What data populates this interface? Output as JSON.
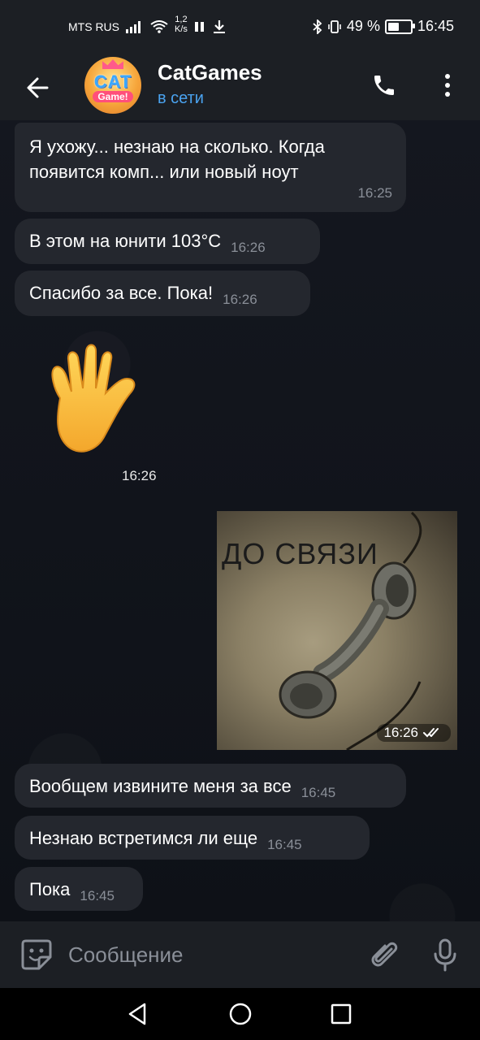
{
  "status_bar": {
    "carrier": "MTS RUS",
    "speed_value": "1,2",
    "speed_unit": "K/s",
    "battery": "49 %",
    "time": "16:45",
    "battery_level": 0.49
  },
  "header": {
    "title": "CatGames",
    "status": "в сети",
    "avatar": {
      "line1": "CAT",
      "line2": "Game!"
    },
    "icons": {
      "back": "arrow-left-icon",
      "call": "phone-icon",
      "more": "more-vertical-icon"
    }
  },
  "messages": [
    {
      "type": "text",
      "text": "Я ухожу... незнаю на сколько. Когда появится комп... или новый ноут",
      "time": "16:25"
    },
    {
      "type": "text",
      "text": "В этом на юнити 103°C",
      "time": "16:26"
    },
    {
      "type": "text",
      "text": "Спасибо за все. Пока!",
      "time": "16:26"
    },
    {
      "type": "sticker",
      "emoji": "waving-hand",
      "time": "16:26"
    },
    {
      "type": "photo",
      "caption": "ДО СВЯЗИ",
      "time": "16:26",
      "status": "read"
    },
    {
      "type": "text",
      "text": "Вообщем извините меня за все",
      "time": "16:45"
    },
    {
      "type": "text",
      "text": "Незнаю встретимся ли еще",
      "time": "16:45"
    },
    {
      "type": "text",
      "text": "Пока",
      "time": "16:45"
    }
  ],
  "input": {
    "placeholder": "Сообщение",
    "icons": {
      "emoji": "sticker-smile-icon",
      "attach": "paperclip-icon",
      "mic": "microphone-icon"
    }
  },
  "nav": {
    "icons": [
      "nav-back-icon",
      "nav-home-icon",
      "nav-recent-icon"
    ]
  },
  "colors": {
    "accent": "#4aa3f0",
    "bubble": "#24272e",
    "bar": "#1c1f24"
  }
}
